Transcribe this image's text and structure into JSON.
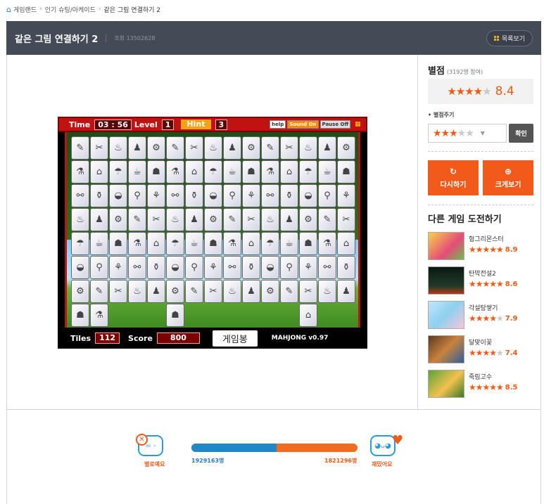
{
  "breadcrumb": {
    "home": "게임랜드",
    "category": "인기 슈팅/아케이드",
    "current": "같은 그림 연결하기 2"
  },
  "header": {
    "title": "같은 그림 연결하기 2",
    "views_label": "조회 13502628",
    "list_button": "목록보기"
  },
  "game": {
    "time_label": "Time",
    "time_value": "03 : 56",
    "level_label": "Level",
    "level_value": "1",
    "hint_label": "Hint",
    "hint_value": "3",
    "help": "help",
    "sound": "Sound On",
    "pause": "Pause Off",
    "tiles_label": "Tiles",
    "tiles_value": "112",
    "score_label": "Score",
    "score_value": "800",
    "logo": "게임봉",
    "version": "MAHJONG v0.97"
  },
  "rating": {
    "title": "별점",
    "participants": "(3192명 참여)",
    "value": "8.4",
    "stars": 4,
    "give_label": "• 별점주기",
    "my_stars": 3,
    "confirm": "확인"
  },
  "actions": {
    "replay": "다시하기",
    "enlarge": "크게보기"
  },
  "other_games": {
    "title": "다른 게임 도전하기",
    "items": [
      {
        "name": "헝그리몬스터",
        "score": "8.9",
        "stars": 4.5
      },
      {
        "name": "탄막전설2",
        "score": "8.6",
        "stars": 4.5
      },
      {
        "name": "각설탕쌓기",
        "score": "7.9",
        "stars": 4
      },
      {
        "name": "달맞이꽃",
        "score": "7.4",
        "stars": 3.5
      },
      {
        "name": "죽림고수",
        "score": "8.5",
        "stars": 4.5
      }
    ]
  },
  "vote": {
    "dislike_label": "별로예요",
    "like_label": "재밌어요",
    "dislike_count": "1929163명",
    "like_count": "1821296명",
    "dislike_share": 0.514
  },
  "colors": {
    "accent": "#f15a1b",
    "header_bg": "#444b57",
    "blue": "#1f88c8"
  }
}
